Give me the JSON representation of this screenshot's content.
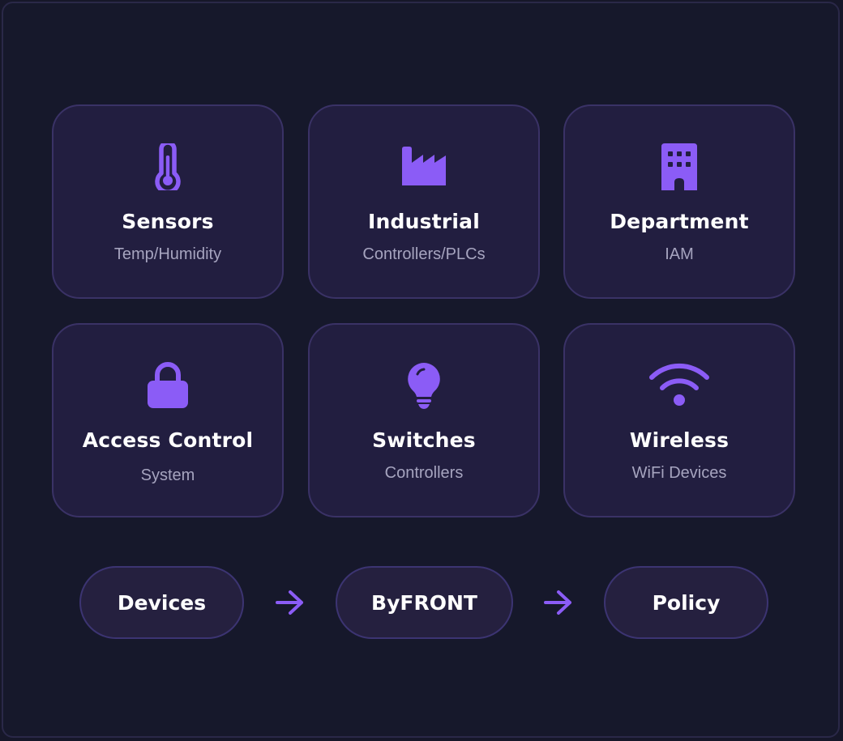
{
  "cards": [
    {
      "title": "Sensors",
      "subtitle": "Temp/Humidity",
      "icon": "thermometer-icon"
    },
    {
      "title": "Industrial",
      "subtitle": "Controllers/PLCs",
      "icon": "factory-icon"
    },
    {
      "title": "Department",
      "subtitle": "IAM",
      "icon": "building-icon"
    },
    {
      "title": "Access Control",
      "subtitle": "System",
      "icon": "lock-icon"
    },
    {
      "title": "Switches",
      "subtitle": "Controllers",
      "icon": "lightbulb-icon"
    },
    {
      "title": "Wireless",
      "subtitle": "WiFi Devices",
      "icon": "wifi-icon"
    }
  ],
  "flow": {
    "steps": [
      "Devices",
      "ByFRONT",
      "Policy"
    ],
    "arrow_icon": "arrow-right-icon"
  },
  "colors": {
    "accent": "#8b5cf6",
    "background": "#161729",
    "card": "#221e40",
    "card_border": "#3a3266",
    "subtitle": "#a6a4bf"
  }
}
